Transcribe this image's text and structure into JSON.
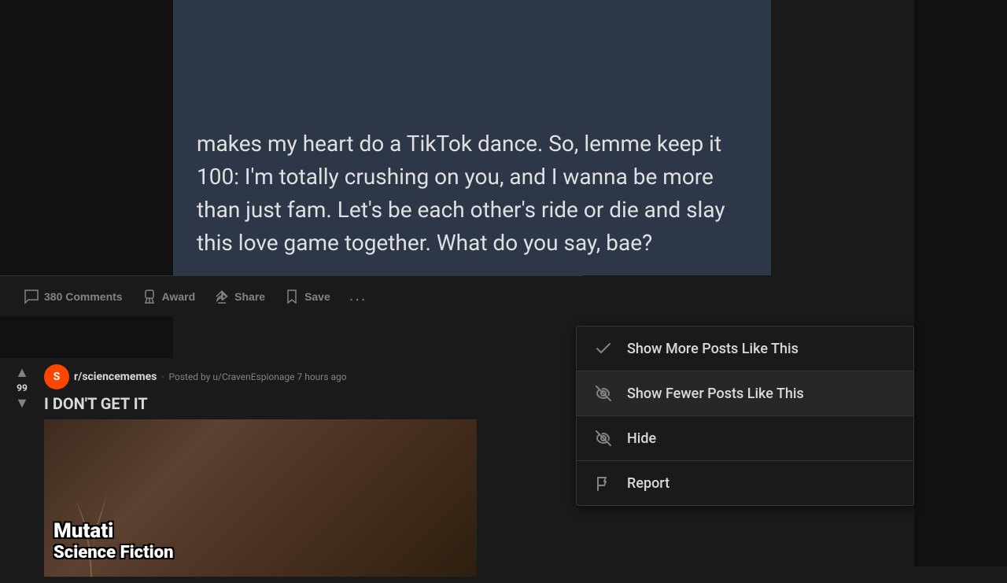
{
  "post_content": {
    "text": "makes my heart do a TikTok dance. So, lemme keep it 100: I'm totally crushing on you, and I wanna be more than just fam. Let's be each other's ride or die and slay this love game together. What do you say, bae?"
  },
  "action_bar": {
    "comments": {
      "label": "380 Comments",
      "count": "380"
    },
    "award": {
      "label": "Award"
    },
    "share": {
      "label": "Share"
    },
    "save": {
      "label": "Save"
    },
    "more": {
      "label": "..."
    }
  },
  "post_below": {
    "subreddit": "r/sciencememes",
    "posted_by": "Posted by u/CravenEspionage 7 hours ago",
    "vote_count": "99",
    "title": "I DON'T GET IT",
    "image_text": "Mutati\nScience Fiction"
  },
  "dropdown_menu": {
    "items": [
      {
        "id": "show-more",
        "label": "Show More Posts Like This",
        "icon": "checkmark"
      },
      {
        "id": "show-fewer",
        "label": "Show Fewer Posts Like This",
        "icon": "eye-slash",
        "hovered": true
      },
      {
        "id": "hide",
        "label": "Hide",
        "icon": "eye-slash"
      },
      {
        "id": "report",
        "label": "Report",
        "icon": "flag"
      }
    ]
  }
}
